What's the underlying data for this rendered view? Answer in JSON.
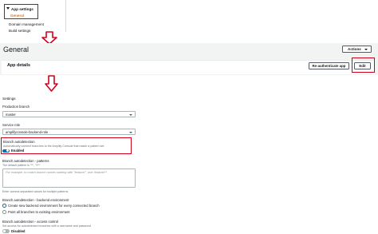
{
  "nav": {
    "parent": "App settings",
    "active": "General",
    "items": [
      "Domain management",
      "Build settings"
    ]
  },
  "header": {
    "title": "General",
    "actions_label": "Actions"
  },
  "details": {
    "title": "App details",
    "reauth_label": "Re-authenticate app",
    "edit_label": "Edit"
  },
  "settings": {
    "title": "Settings",
    "production_branch": {
      "label": "Production branch",
      "value": "master"
    },
    "service_role": {
      "label": "Service role",
      "value": "amplifyconsole-backend-role"
    },
    "autodetection": {
      "label": "Branch autodetection",
      "description": "Automatically connect branches to the Amplify Console that match a pattern set.",
      "toggle_label": "Enabled"
    },
    "patterns": {
      "label": "Branch autodetection - patterns",
      "description": "The default pattern is '**', '*/**'",
      "placeholder": "For example, to match branch names starting with \"feature/\", use: feature/**",
      "hint": "Enter comma separated values for multiple patterns"
    },
    "backend_env": {
      "label": "Branch autodetection - backend environment",
      "options": [
        "Create new backend environment for every connected branch",
        "Point all branches to existing environment"
      ]
    },
    "access_control": {
      "label": "Branch autodetection - access control",
      "description": "Set access for autodetected branches with a username and password",
      "toggle_label": "Disabled"
    }
  },
  "colors": {
    "highlight": "#d0021b",
    "accent": "#0073bb",
    "nav_active": "#ec7211"
  },
  "icons": [
    "nav-chevron-down-icon",
    "annotation-down-arrow-icon",
    "annotation-down-arrow-icon",
    "dropdown-caret-icon"
  ]
}
